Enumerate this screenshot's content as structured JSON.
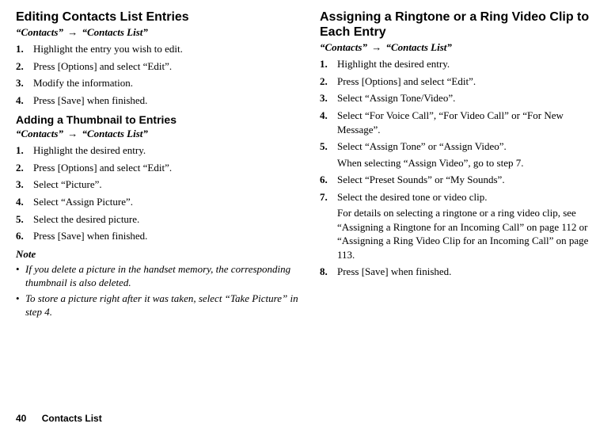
{
  "left": {
    "section1": {
      "heading": "Editing Contacts List Entries",
      "crumb_a": "“Contacts”",
      "crumb_b": "“Contacts List”",
      "steps": [
        "Highlight the entry you wish to edit.",
        "Press [Options] and select “Edit”.",
        "Modify the information.",
        "Press [Save] when finished."
      ]
    },
    "section2": {
      "heading": "Adding a Thumbnail to Entries",
      "crumb_a": "“Contacts”",
      "crumb_b": "“Contacts List”",
      "steps": [
        "Highlight the desired entry.",
        "Press [Options] and select “Edit”.",
        "Select “Picture”.",
        "Select “Assign Picture”.",
        "Select the desired picture.",
        "Press [Save] when finished."
      ]
    },
    "note_label": "Note",
    "notes": [
      "If you delete a picture in the handset memory, the corresponding thumbnail is also deleted.",
      "To store a picture right after it was taken, select “Take Picture” in step 4."
    ]
  },
  "right": {
    "heading": "Assigning a Ringtone or a Ring Video Clip to Each Entry",
    "crumb_a": "“Contacts”",
    "crumb_b": "“Contacts List”",
    "steps": [
      {
        "t": "Highlight the desired entry."
      },
      {
        "t": "Press [Options] and select “Edit”."
      },
      {
        "t": "Select “Assign Tone/Video”."
      },
      {
        "t": "Select “For Voice Call”, “For Video Call” or “For New Message”."
      },
      {
        "t": "Select “Assign Tone” or “Assign Video”.",
        "sub": "When selecting “Assign Video”, go to step 7."
      },
      {
        "t": "Select “Preset Sounds” or “My Sounds”."
      },
      {
        "t": "Select the desired tone or video clip.",
        "sub": "For details on selecting a ringtone or a ring video clip, see “Assigning a Ringtone for an Incoming Call” on page 112 or “Assigning a Ring Video Clip for an Incoming Call” on page 113."
      },
      {
        "t": "Press [Save] when finished."
      }
    ]
  },
  "arrow": "→",
  "footer": {
    "page": "40",
    "section": "Contacts List"
  }
}
